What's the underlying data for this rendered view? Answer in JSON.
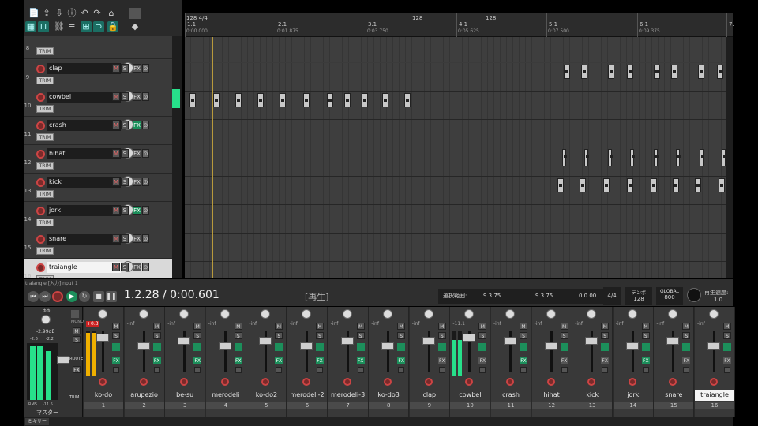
{
  "colors": {
    "accent": "#1b6e63",
    "meter_green": "#27e08a",
    "meter_yellow": "#f0b000",
    "rec_red": "#c44444",
    "fx_green": "#1c8f5b"
  },
  "toolbar": {
    "icons": [
      "new-project-icon",
      "open-icon",
      "save-icon",
      "info-icon",
      "undo-icon",
      "redo-icon",
      "metronome-icon",
      "grid-icon",
      "snap-icon",
      "link-icon",
      "ripple-icon",
      "group-icon",
      "loop-icon",
      "lock-icon",
      "pin-icon"
    ]
  },
  "ruler": {
    "markers": [
      {
        "bar": "1.1",
        "time": "0:00.000"
      },
      {
        "bar": "2.1",
        "time": "0:01.875"
      },
      {
        "bar": "3.1",
        "time": "0:03.750"
      },
      {
        "bar": "4.1",
        "time": "0:05.625"
      },
      {
        "bar": "5.1",
        "time": "0:07.500"
      },
      {
        "bar": "6.1",
        "time": "0:09.375"
      },
      {
        "bar": "7.",
        "time": ""
      }
    ],
    "tempo_top": "128 4/4",
    "tempo_mark_a": "128",
    "tempo_mark_b": "128"
  },
  "tracks": [
    {
      "num": "8",
      "name": "",
      "fx_on": false,
      "trim": "TRIM"
    },
    {
      "num": "9",
      "name": "clap",
      "fx_on": false,
      "trim": "TRIM"
    },
    {
      "num": "10",
      "name": "cowbel",
      "fx_on": false,
      "trim": "TRIM"
    },
    {
      "num": "11",
      "name": "crash",
      "fx_on": true,
      "trim": "TRIM"
    },
    {
      "num": "12",
      "name": "hihat",
      "fx_on": false,
      "trim": "TRIM"
    },
    {
      "num": "13",
      "name": "kick",
      "fx_on": false,
      "trim": "TRIM"
    },
    {
      "num": "14",
      "name": "jork",
      "fx_on": true,
      "trim": "TRIM"
    },
    {
      "num": "15",
      "name": "snare",
      "fx_on": false,
      "trim": "TRIM"
    },
    {
      "num": "16",
      "name": "traiangle",
      "fx_on": false,
      "trim": "TRIM"
    }
  ],
  "button_labels": {
    "mute": "M",
    "solo": "S",
    "fx": "FX",
    "trim": "TRIM"
  },
  "status_line": "traiangle [入力]Input 1",
  "transport": {
    "position": "1.2.28 / 0:00.601",
    "state": "[再生]",
    "selection_label": "選択範囲:",
    "sel_start": "9.3.75",
    "sel_end": "9.3.75",
    "sel_length": "0.0.00",
    "time_sig": "4/4",
    "tempo_label": "テンポ",
    "tempo": "128",
    "global_label": "GLOBAL",
    "global_value": "800",
    "rate_label": "再生速度:",
    "rate": "1.0"
  },
  "master": {
    "label": "マスター",
    "peak": "-2.99dB",
    "left_db": "-2.6",
    "right_db": "-2.2",
    "rms_label": "RMS",
    "rms_val": "-11.5",
    "routing": "ROUTE",
    "mono": "MONO",
    "trim": "TRIM"
  },
  "mixer_strips": [
    {
      "name": "ko-do",
      "num": "1",
      "db": "+0.3",
      "fx_on": true,
      "level": 0.95,
      "meter": "yellow"
    },
    {
      "name": "arupezio",
      "num": "2",
      "db": "-inf",
      "fx_on": true,
      "level": 0.0,
      "meter": "none"
    },
    {
      "name": "be-su",
      "num": "3",
      "db": "-inf",
      "fx_on": true,
      "level": 0.0,
      "meter": "none"
    },
    {
      "name": "merodeli",
      "num": "4",
      "db": "-inf",
      "fx_on": true,
      "level": 0.0,
      "meter": "none"
    },
    {
      "name": "ko-do2",
      "num": "5",
      "db": "-inf",
      "fx_on": true,
      "level": 0.0,
      "meter": "none"
    },
    {
      "name": "merodeli-2",
      "num": "6",
      "db": "-inf",
      "fx_on": true,
      "level": 0.0,
      "meter": "none"
    },
    {
      "name": "merodeli-3",
      "num": "7",
      "db": "-inf",
      "fx_on": true,
      "level": 0.0,
      "meter": "none"
    },
    {
      "name": "ko-do3",
      "num": "8",
      "db": "-inf",
      "fx_on": true,
      "level": 0.0,
      "meter": "none"
    },
    {
      "name": "clap",
      "num": "9",
      "db": "-inf",
      "fx_on": false,
      "level": 0.0,
      "meter": "none"
    },
    {
      "name": "cowbel",
      "num": "10",
      "db": "-11.1",
      "fx_on": false,
      "level": 0.8,
      "meter": "green"
    },
    {
      "name": "crash",
      "num": "11",
      "db": "-inf",
      "fx_on": true,
      "level": 0.0,
      "meter": "none"
    },
    {
      "name": "hihat",
      "num": "12",
      "db": "-inf",
      "fx_on": false,
      "level": 0.0,
      "meter": "none"
    },
    {
      "name": "kick",
      "num": "13",
      "db": "-inf",
      "fx_on": false,
      "level": 0.0,
      "meter": "none"
    },
    {
      "name": "jork",
      "num": "14",
      "db": "-inf",
      "fx_on": true,
      "level": 0.0,
      "meter": "none"
    },
    {
      "name": "snare",
      "num": "15",
      "db": "-inf",
      "fx_on": false,
      "level": 0.0,
      "meter": "none"
    },
    {
      "name": "traiangle",
      "num": "16",
      "db": "-inf",
      "fx_on": false,
      "level": 0.0,
      "meter": "none"
    }
  ],
  "mixer_tab": "ミキサー"
}
